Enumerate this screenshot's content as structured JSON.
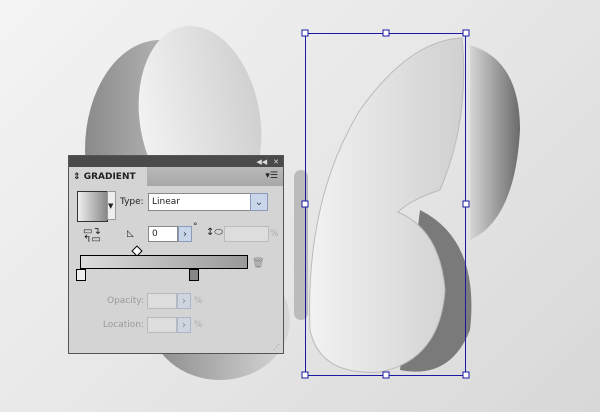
{
  "panel": {
    "title": "GRADIENT",
    "collapse_icon": "double-left-arrow",
    "close_icon": "x",
    "menu_icon": "panel-menu",
    "type_label": "Type:",
    "type_value": "Linear",
    "angle_value": "0",
    "degree_symbol": "°",
    "aspect_value": "",
    "percent": "%",
    "opacity_label": "Opacity:",
    "opacity_value": "",
    "location_label": "Location:",
    "location_value": ""
  },
  "colors": {
    "selection": "#1a1aa0",
    "panel_bg": "#d4d4d4"
  }
}
